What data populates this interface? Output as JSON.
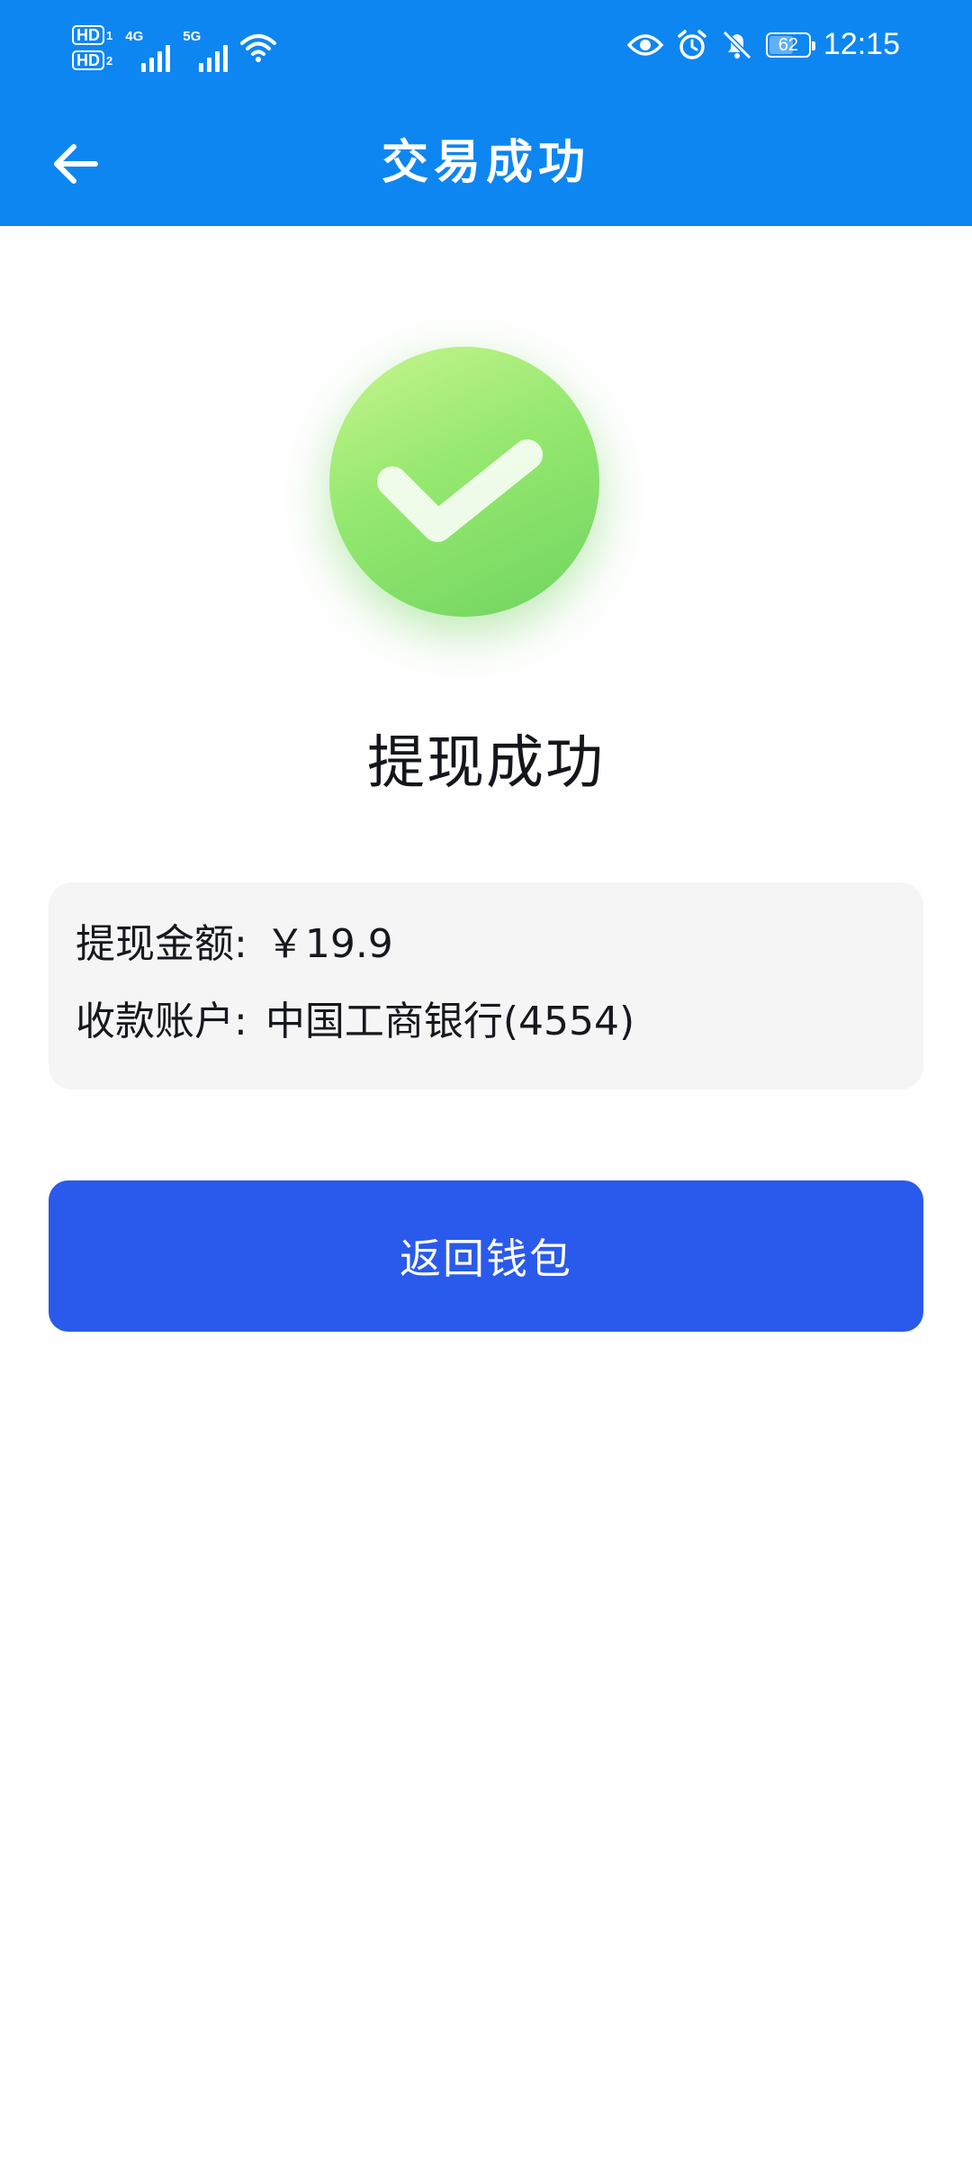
{
  "status_bar": {
    "sim1_badge": "HD",
    "sim1_index": "1",
    "sim2_badge": "HD",
    "sim2_index": "2",
    "network1_label": "4G",
    "network2_label": "5G",
    "battery_percent": "62",
    "battery_level": 0.62,
    "time": "12:15",
    "icons": [
      "eye-icon",
      "alarm-icon",
      "bell-off-icon",
      "battery-icon",
      "wifi-icon",
      "signal-icon"
    ]
  },
  "header": {
    "title": "交易成功",
    "background_color": "#0d86f2"
  },
  "result": {
    "title": "提现成功",
    "icon": "check-circle-icon",
    "icon_colors": [
      "#c8f58f",
      "#6fd460"
    ]
  },
  "details": {
    "amount_label": "提现金额:",
    "amount_value": "￥19.9",
    "account_label": "收款账户:",
    "account_value": "中国工商银行(4554)"
  },
  "actions": {
    "back_to_wallet": "返回钱包",
    "button_color": "#2a5aeb"
  }
}
